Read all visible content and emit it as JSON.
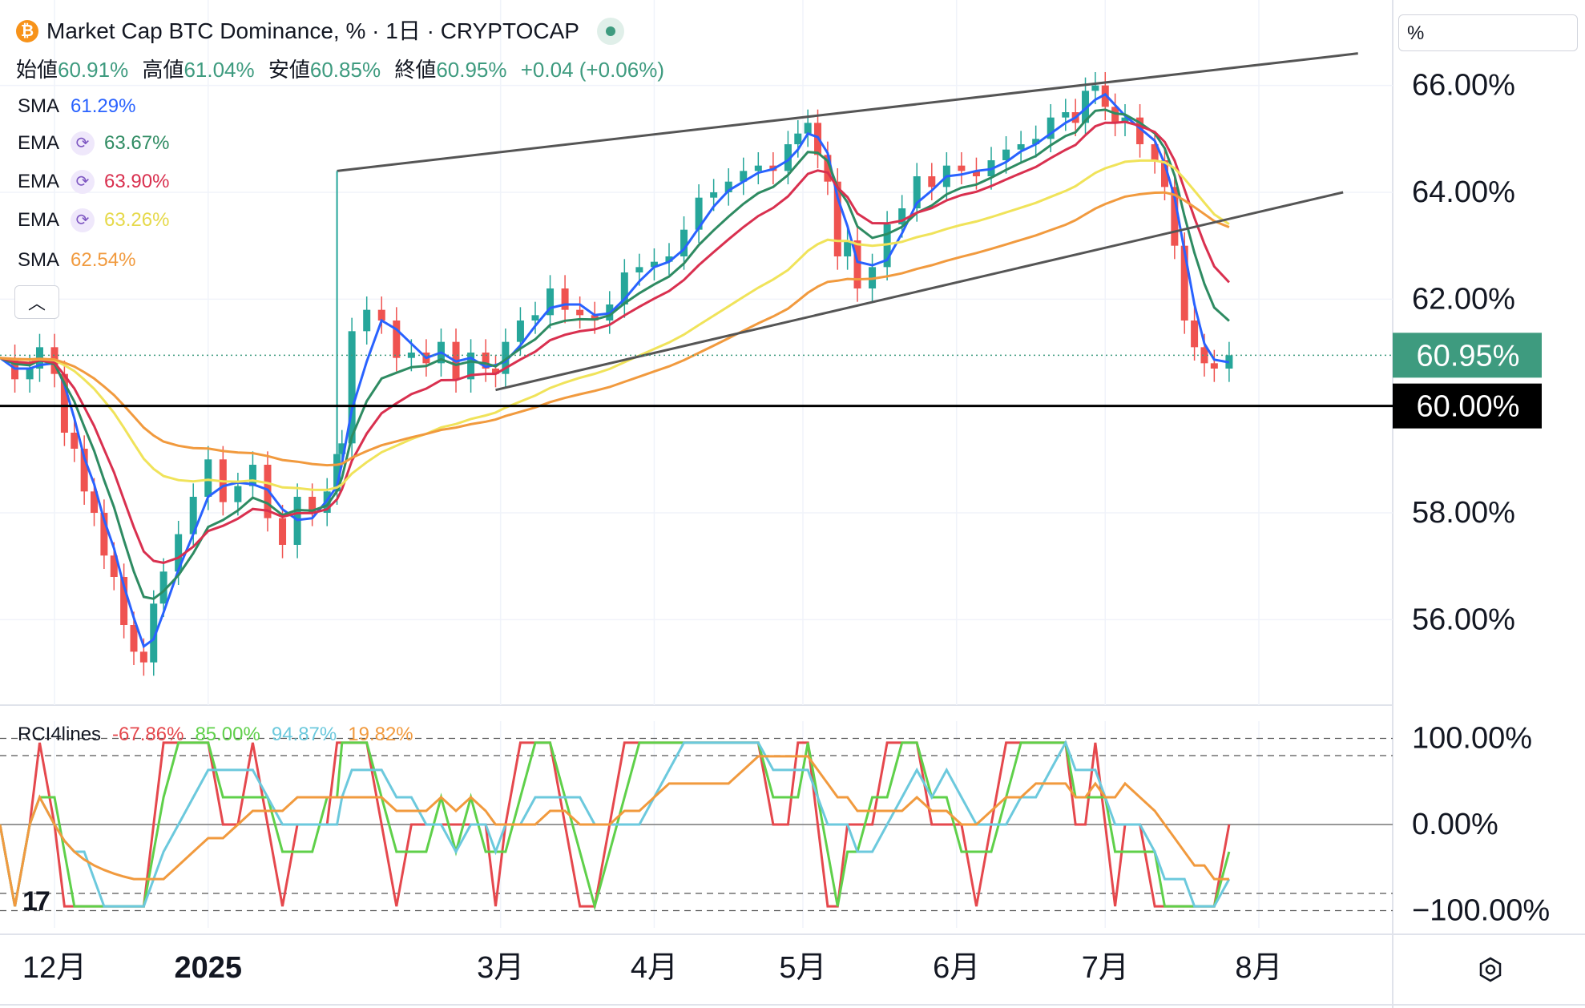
{
  "header": {
    "title": "Market Cap BTC Dominance, % · 1日 · CRYPTOCAP",
    "ohlc": [
      {
        "key": "始値",
        "value": "60.91%"
      },
      {
        "key": "高値",
        "value": "61.04%"
      },
      {
        "key": "安値",
        "value": "60.85%"
      },
      {
        "key": "終値",
        "value": "60.95%"
      },
      {
        "key": "",
        "value": "+0.04 (+0.06%)"
      }
    ]
  },
  "indicators": [
    {
      "name": "SMA",
      "value": "61.29%",
      "color": "#2962ff",
      "has_icon": false
    },
    {
      "name": "EMA",
      "value": "63.67%",
      "color": "#2e8b62",
      "has_icon": true
    },
    {
      "name": "EMA",
      "value": "63.90%",
      "color": "#d9304f",
      "has_icon": true
    },
    {
      "name": "EMA",
      "value": "63.26%",
      "color": "#f0e35a",
      "has_icon": true
    },
    {
      "name": "SMA",
      "value": "62.54%",
      "color": "#f19a3e",
      "has_icon": false
    }
  ],
  "unit_label": "%",
  "rci": {
    "name": "RCI4lines",
    "values": [
      {
        "value": "-67.86%",
        "color": "#e5484d"
      },
      {
        "value": "85.00%",
        "color": "#5fd04a"
      },
      {
        "value": "94.87%",
        "color": "#6cc9dd"
      },
      {
        "value": "19.82%",
        "color": "#f19a3e"
      }
    ]
  },
  "badges": {
    "current": "60.95%",
    "line": "60.00%"
  },
  "colors": {
    "up": "#26a69a",
    "down": "#ef5350",
    "current_badge": "#3e9b7f",
    "line_badge": "#000000"
  },
  "chart_data": {
    "type": "candlestick",
    "title": "Market Cap BTC Dominance, % · 1日 · CRYPTOCAP",
    "x_ticks": [
      "12月",
      "2025",
      "3月",
      "4月",
      "5月",
      "6月",
      "7月",
      "8月"
    ],
    "y_ticks": [
      "56.00%",
      "58.00%",
      "60.00%",
      "62.00%",
      "64.00%",
      "66.00%"
    ],
    "ylim": [
      54.4,
      67.6
    ],
    "x_range": [
      "2024-11-20",
      "2025-08-28"
    ],
    "horizontal_line": 60.0,
    "current_value": 60.95,
    "trendlines": [
      {
        "from": [
          "2025-01-27",
          64.4
        ],
        "to": [
          "2025-08-21",
          66.6
        ]
      },
      {
        "from": [
          "2025-02-28",
          60.3
        ],
        "to": [
          "2025-08-18",
          64.0
        ]
      }
    ],
    "close_series": {
      "x": [
        "2024-11-20",
        "2024-11-23",
        "2024-11-26",
        "2024-11-28",
        "2024-12-01",
        "2024-12-03",
        "2024-12-05",
        "2024-12-07",
        "2024-12-09",
        "2024-12-11",
        "2024-12-13",
        "2024-12-15",
        "2024-12-17",
        "2024-12-19",
        "2024-12-21",
        "2024-12-23",
        "2024-12-26",
        "2024-12-29",
        "2025-01-01",
        "2025-01-04",
        "2025-01-07",
        "2025-01-10",
        "2025-01-13",
        "2025-01-16",
        "2025-01-19",
        "2025-01-22",
        "2025-01-25",
        "2025-01-27",
        "2025-01-28",
        "2025-01-30",
        "2025-02-02",
        "2025-02-05",
        "2025-02-08",
        "2025-02-11",
        "2025-02-14",
        "2025-02-17",
        "2025-02-20",
        "2025-02-23",
        "2025-02-26",
        "2025-02-28",
        "2025-03-02",
        "2025-03-05",
        "2025-03-08",
        "2025-03-11",
        "2025-03-14",
        "2025-03-17",
        "2025-03-20",
        "2025-03-23",
        "2025-03-26",
        "2025-03-29",
        "2025-04-01",
        "2025-04-04",
        "2025-04-07",
        "2025-04-10",
        "2025-04-13",
        "2025-04-16",
        "2025-04-19",
        "2025-04-22",
        "2025-04-25",
        "2025-04-28",
        "2025-04-30",
        "2025-05-02",
        "2025-05-04",
        "2025-05-06",
        "2025-05-08",
        "2025-05-10",
        "2025-05-12",
        "2025-05-15",
        "2025-05-18",
        "2025-05-21",
        "2025-05-24",
        "2025-05-27",
        "2025-05-30",
        "2025-06-02",
        "2025-06-05",
        "2025-06-08",
        "2025-06-11",
        "2025-06-14",
        "2025-06-17",
        "2025-06-20",
        "2025-06-23",
        "2025-06-25",
        "2025-06-27",
        "2025-06-29",
        "2025-07-01",
        "2025-07-03",
        "2025-07-05",
        "2025-07-08",
        "2025-07-11",
        "2025-07-13",
        "2025-07-15",
        "2025-07-17",
        "2025-07-19",
        "2025-07-21",
        "2025-07-23",
        "2025-07-26"
      ],
      "y": [
        60.9,
        60.5,
        60.7,
        61.1,
        60.6,
        59.5,
        59.2,
        58.4,
        58.0,
        57.2,
        56.8,
        55.9,
        55.4,
        55.2,
        56.3,
        56.9,
        57.6,
        58.3,
        59.0,
        58.2,
        58.5,
        58.9,
        57.9,
        57.4,
        58.3,
        58.0,
        58.4,
        59.1,
        59.3,
        61.4,
        61.8,
        61.6,
        60.9,
        61.0,
        60.8,
        61.2,
        60.5,
        61.0,
        60.7,
        60.6,
        61.2,
        61.6,
        61.7,
        62.2,
        61.8,
        61.7,
        61.6,
        61.9,
        62.5,
        62.6,
        62.7,
        62.8,
        63.3,
        63.9,
        64.0,
        64.2,
        64.4,
        64.5,
        64.4,
        64.9,
        65.1,
        65.3,
        64.7,
        64.2,
        62.8,
        63.1,
        62.2,
        62.6,
        63.4,
        63.7,
        64.3,
        64.1,
        64.5,
        64.4,
        64.3,
        64.6,
        64.8,
        64.9,
        65.0,
        65.4,
        65.5,
        65.3,
        65.9,
        66.0,
        65.6,
        65.3,
        65.4,
        64.9,
        64.6,
        64.1,
        63.0,
        61.6,
        61.1,
        60.8,
        60.7,
        60.95
      ]
    },
    "series": [
      {
        "name": "SMA",
        "last": 61.29
      },
      {
        "name": "EMA",
        "last": 63.67
      },
      {
        "name": "EMA",
        "last": 63.9
      },
      {
        "name": "EMA",
        "last": 63.26
      },
      {
        "name": "SMA",
        "last": 62.54
      }
    ],
    "rci_panel": {
      "name": "RCI4lines",
      "y_ticks": [
        "100.00%",
        "0.00%",
        "−100.00%"
      ],
      "ylim": [
        -120,
        120
      ],
      "series": [
        {
          "name": "",
          "last": -67.86
        },
        {
          "name": "",
          "last": 85.0
        },
        {
          "name": "",
          "last": 94.87
        },
        {
          "name": "",
          "last": 19.82
        }
      ]
    }
  }
}
